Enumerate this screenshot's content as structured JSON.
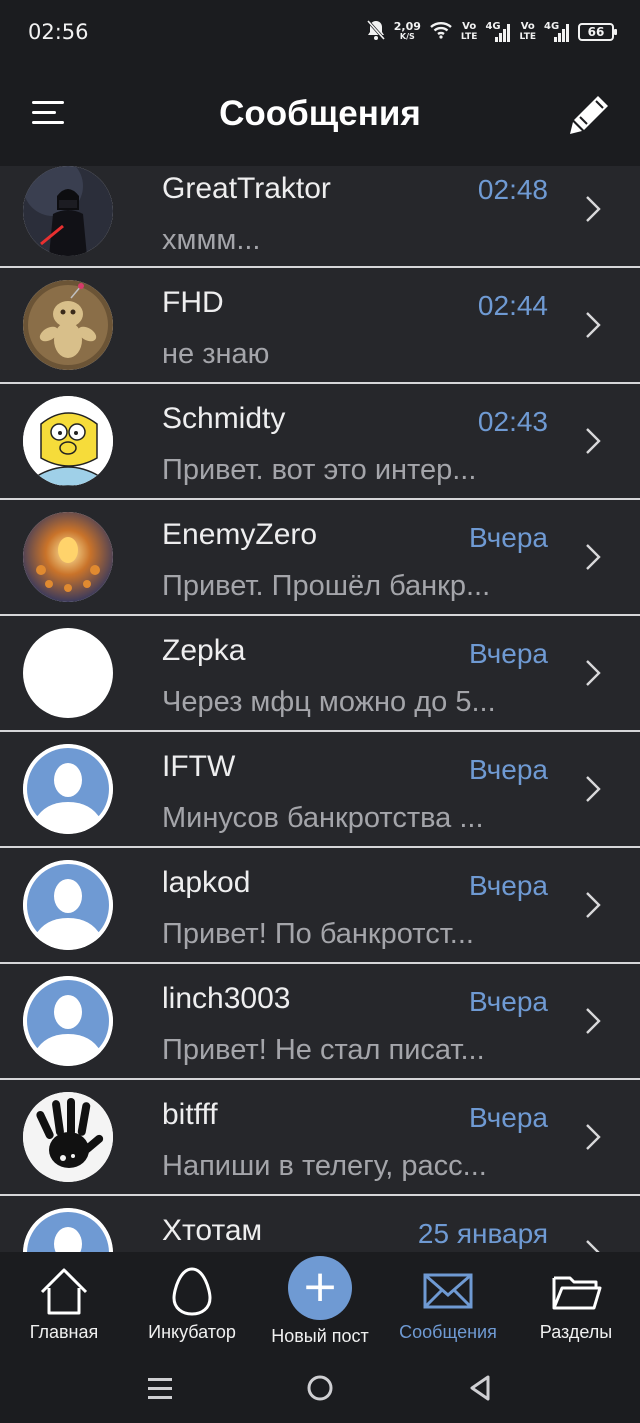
{
  "status_bar": {
    "time": "02:56",
    "net_speed_value": "2,09",
    "net_speed_unit": "K/S",
    "sim1_top": "Vo",
    "sim1_bottom": "LTE",
    "sim1_gen": "4G",
    "sim2_top": "Vo",
    "sim2_bottom": "LTE",
    "sim2_gen": "4G",
    "battery": "66"
  },
  "header": {
    "title": "Сообщения"
  },
  "colors": {
    "accent": "#6f9ad3",
    "background": "#1b1c1f",
    "row_background": "#26272b",
    "divider": "#d6d6d9"
  },
  "messages": [
    {
      "name": "GreatTraktor",
      "time": "02:48",
      "preview": "хммм...",
      "avatar": "darth-vader-avatar"
    },
    {
      "name": "FHD",
      "time": "02:44",
      "preview": "не знаю",
      "avatar": "voodoo-doll-avatar"
    },
    {
      "name": "Schmidty",
      "time": "02:43",
      "preview": "Привет. вот это интер...",
      "avatar": "cartoon-character-avatar"
    },
    {
      "name": "EnemyZero",
      "time": "Вчера",
      "preview": "Привет. Прошёл банкр...",
      "avatar": "glowing-figure-avatar"
    },
    {
      "name": "Zepka",
      "time": "Вчера",
      "preview": "Через мфц можно до 5...",
      "avatar": "blank-white-avatar"
    },
    {
      "name": "IFTW",
      "time": "Вчера",
      "preview": "Минусов банкротства ...",
      "avatar": "default-user-avatar"
    },
    {
      "name": "lapkod",
      "time": "Вчера",
      "preview": "Привет! По банкротст...",
      "avatar": "default-user-avatar"
    },
    {
      "name": "linch3003",
      "time": "Вчера",
      "preview": "Привет! Не стал писат...",
      "avatar": "default-user-avatar"
    },
    {
      "name": "bitfff",
      "time": "Вчера",
      "preview": "Напиши в телегу, расс...",
      "avatar": "hand-print-avatar"
    },
    {
      "name": "Хтотам",
      "time": "25 января",
      "preview": "",
      "avatar": "default-user-avatar"
    }
  ],
  "bottom_nav": {
    "home": "Главная",
    "incubator": "Инкубатор",
    "new_post": "Новый пост",
    "messages": "Сообщения",
    "sections": "Разделы",
    "fab_symbol": "+"
  }
}
